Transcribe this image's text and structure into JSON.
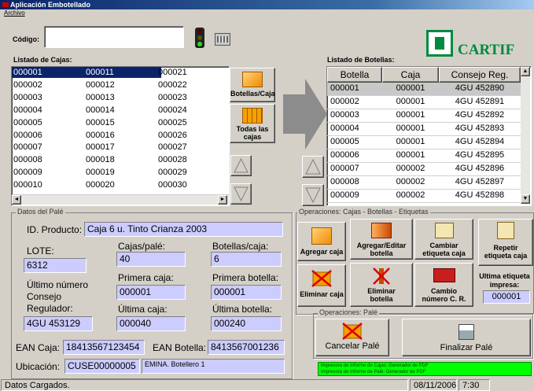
{
  "window": {
    "title": "Aplicación Embotellado"
  },
  "menu": {
    "archivo": "Archivo"
  },
  "codigo": {
    "label": "Código:",
    "value": ""
  },
  "logo": {
    "text": "CARTIF"
  },
  "cajas": {
    "label": "Listado de Cajas:",
    "columns": [
      [
        "000001",
        "000002",
        "000003",
        "000004",
        "000005",
        "000006",
        "000007",
        "000008",
        "000009",
        "000010"
      ],
      [
        "000011",
        "000012",
        "000013",
        "000014",
        "000015",
        "000016",
        "000017",
        "000018",
        "000019",
        "000020"
      ],
      [
        "000021",
        "000022",
        "000023",
        "000024",
        "000025",
        "000026",
        "000027",
        "000028",
        "000029",
        "000030"
      ]
    ]
  },
  "buttons": {
    "botellas_caja": "Botellas/Caja",
    "todas_cajas_1": "Todas las",
    "todas_cajas_2": "cajas"
  },
  "botellas": {
    "label": "Listado de Botellas:",
    "headers": [
      "Botella",
      "Caja",
      "Consejo Reg."
    ],
    "rows": [
      [
        "000001",
        "000001",
        "4GU 452890"
      ],
      [
        "000002",
        "000001",
        "4GU 452891"
      ],
      [
        "000003",
        "000001",
        "4GU 452892"
      ],
      [
        "000004",
        "000001",
        "4GU 452893"
      ],
      [
        "000005",
        "000001",
        "4GU 452894"
      ],
      [
        "000006",
        "000001",
        "4GU 452895"
      ],
      [
        "000007",
        "000002",
        "4GU 452896"
      ],
      [
        "000008",
        "000002",
        "4GU 452897"
      ],
      [
        "000009",
        "000002",
        "4GU 452898"
      ]
    ]
  },
  "pale": {
    "group_label": "Datos del Palé",
    "id_label": "ID. Producto:",
    "id_value": "Caja 6 u. Tinto Crianza 2003",
    "lote_label": "LOTE:",
    "lote_value": "6312",
    "cajas_pale_label": "Cajas/palé:",
    "cajas_pale_value": "40",
    "botellas_caja_label": "Botellas/caja:",
    "botellas_caja_value": "6",
    "ultimo_num_1": "Último número",
    "ultimo_num_2": "Consejo",
    "ultimo_num_3": "Regulador:",
    "ultimo_num_value": "4GU 453129",
    "primera_caja_label": "Primera caja:",
    "primera_caja_value": "000001",
    "primera_botella_label": "Primera botella:",
    "primera_botella_value": "000001",
    "ultima_caja_label": "Última caja:",
    "ultima_caja_value": "000040",
    "ultima_botella_label": "Última botella:",
    "ultima_botella_value": "000240",
    "ean_caja_label": "EAN Caja:",
    "ean_caja_value": "18413567123454",
    "ean_botella_label": "EAN Botella:",
    "ean_botella_value": "8413567001236",
    "ubicacion_label": "Ubicación:",
    "ubicacion_value": "CUSE00000005",
    "ubicacion_desc": "EMINA. Botellero 1"
  },
  "ops": {
    "group_label": "Operaciones: Cajas - Botellas - Etiquetas",
    "agregar_caja": "Agregar caja",
    "agregar_botella_1": "Agregar/Editar",
    "agregar_botella_2": "botella",
    "cambiar_etiqueta_1": "Cambiar",
    "cambiar_etiqueta_2": "etiqueta caja",
    "repetir_1": "Repetir",
    "repetir_2": "etiqueta caja",
    "eliminar_caja": "Eliminar caja",
    "eliminar_botella_1": "Eliminar",
    "eliminar_botella_2": "botella",
    "cambio_cr_1": "Cambio",
    "cambio_cr_2": "número C. R.",
    "ultima_etiqueta_1": "Ultima etiqueta",
    "ultima_etiqueta_2": "impresa:",
    "ultima_etiqueta_value": "000001"
  },
  "ops_pale": {
    "group_label": "Operaciones: Palé",
    "cancelar": "Cancelar Palé",
    "finalizar": "Finalizar Palé"
  },
  "printers": {
    "line1": "Impresora de Informe de Cajas:  Generador de PDF",
    "line2": "Impresora de Informe de Palé:  Generador de PDF"
  },
  "status": {
    "text": "Datos Cargados.",
    "date": "08/11/2006",
    "time": "7:30"
  },
  "colors": {
    "lavender": "#ccccff",
    "selection": "#0a246a",
    "printer_bg": "#00ff00",
    "title_bar": "#0a246a"
  }
}
